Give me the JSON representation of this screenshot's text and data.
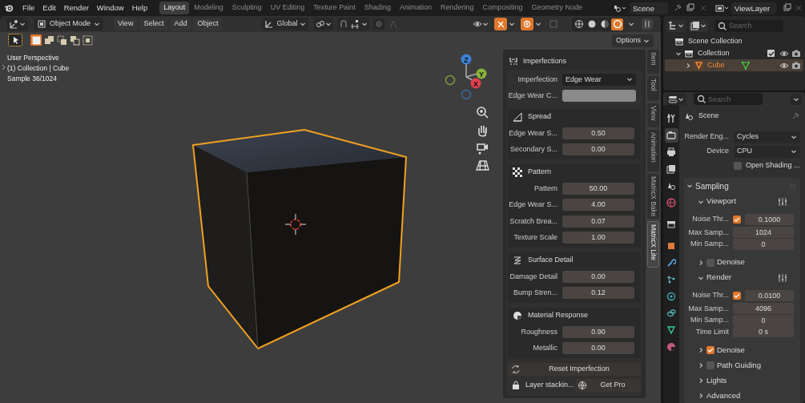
{
  "top_bar": {
    "menus": [
      "File",
      "Edit",
      "Render",
      "Window",
      "Help"
    ],
    "workspaces": [
      {
        "label": "Layout",
        "selected": true
      },
      {
        "label": "Modeling",
        "selected": false
      },
      {
        "label": "Sculpting",
        "selected": false
      },
      {
        "label": "UV Editing",
        "selected": false
      },
      {
        "label": "Texture Paint",
        "selected": false
      },
      {
        "label": "Shading",
        "selected": false
      },
      {
        "label": "Animation",
        "selected": false
      },
      {
        "label": "Rendering",
        "selected": false
      },
      {
        "label": "Compositing",
        "selected": false
      },
      {
        "label": "Geometry Node",
        "selected": false
      }
    ],
    "scene": "Scene",
    "view_layer": "ViewLayer"
  },
  "viewport": {
    "header": {
      "mode": "Object Mode",
      "menus": [
        "View",
        "Select",
        "Add",
        "Object"
      ],
      "orientation": "Global",
      "toggles": [
        {
          "kind": "gizmos",
          "on": true
        },
        {
          "kind": "overlays",
          "on": true
        },
        {
          "kind": "xray",
          "on": false
        }
      ],
      "shading": [
        {
          "kind": "wireframe",
          "selected": false
        },
        {
          "kind": "solid",
          "selected": false
        },
        {
          "kind": "material",
          "selected": false
        },
        {
          "kind": "rendered",
          "selected": true
        }
      ],
      "options": "Options"
    },
    "selection_modes": [
      {
        "kind": "set",
        "selected": true
      },
      {
        "kind": "extend",
        "selected": false
      },
      {
        "kind": "subtract",
        "selected": false
      },
      {
        "kind": "invert",
        "selected": false
      },
      {
        "kind": "intersect",
        "selected": false
      }
    ],
    "overlay_text": [
      "User Perspective",
      "(1) Collection | Cube",
      "Sample 36/1024"
    ],
    "gizmo": [
      "Z",
      "Y",
      "X"
    ]
  },
  "sidebar": {
    "title": "Imperfections",
    "imperfection": {
      "label": "Imperfection",
      "value": "Edge Wear"
    },
    "color": {
      "label": "Edge Wear C...",
      "color": "#8a8a8a"
    },
    "sections": [
      {
        "kind": "spread",
        "title": "Spread",
        "rows": [
          {
            "label": "Edge Wear S...",
            "value": "0.50"
          },
          {
            "label": "Secondary S...",
            "value": "0.00"
          }
        ]
      },
      {
        "kind": "pattern",
        "title": "Pattern",
        "rows": [
          {
            "label": "Pattern",
            "value": "50.00"
          },
          {
            "label": "Edge Wear S...",
            "value": "4.00"
          },
          {
            "label": "Scratch Brea...",
            "value": "0.07"
          },
          {
            "label": "Texture Scale",
            "value": "1.00"
          }
        ]
      },
      {
        "kind": "surface",
        "title": "Surface Detail",
        "rows": [
          {
            "label": "Damage Detail",
            "value": "0.00"
          },
          {
            "label": "Bump Stren...",
            "value": "0.12"
          }
        ]
      },
      {
        "kind": "material",
        "title": "Material Response",
        "rows": [
          {
            "label": "Roughness",
            "value": "0.90"
          },
          {
            "label": "Metallic",
            "value": "0.00"
          }
        ]
      }
    ],
    "reset_button": "Reset Imperfection",
    "footer": {
      "note": "Layer stackin...",
      "button": "Get Pro"
    },
    "tabs": [
      {
        "label": "Item",
        "selected": false
      },
      {
        "label": "Tool",
        "selected": false
      },
      {
        "label": "View",
        "selected": false
      },
      {
        "label": "Animation",
        "selected": false
      },
      {
        "label": "MatricX Bake",
        "selected": false
      },
      {
        "label": "MatricX Lite",
        "selected": true
      }
    ]
  },
  "outliner": {
    "search": {
      "placeholder": "Search"
    },
    "tree": [
      {
        "label": "Scene Collection",
        "selected": false,
        "children": [
          {
            "label": "Collection",
            "selected": false,
            "expanded": true,
            "checked": true,
            "children": [
              {
                "label": "Cube",
                "selected": true,
                "expanded": false
              }
            ]
          }
        ]
      }
    ]
  },
  "properties": {
    "search": {
      "placeholder": "Search"
    },
    "tabs": [
      {
        "kind": "tool",
        "selected": false
      },
      {
        "kind": "render",
        "selected": true
      },
      {
        "kind": "output",
        "selected": false
      },
      {
        "kind": "view_layer",
        "selected": false
      },
      {
        "kind": "scene",
        "selected": false
      },
      {
        "kind": "world",
        "selected": false
      },
      {
        "kind": "collection",
        "selected": false
      },
      {
        "kind": "object",
        "selected": false
      },
      {
        "kind": "modifiers",
        "selected": false
      },
      {
        "kind": "particles",
        "selected": false
      },
      {
        "kind": "physics",
        "selected": false
      },
      {
        "kind": "constraints",
        "selected": false
      },
      {
        "kind": "data",
        "selected": false
      },
      {
        "kind": "material",
        "selected": false
      }
    ],
    "context": "Scene",
    "fields": [
      {
        "kind": "dropdown",
        "label": "Render Eng...",
        "value": "Cycles"
      },
      {
        "kind": "dropdown",
        "label": "Device",
        "value": "CPU"
      },
      {
        "kind": "checkbox",
        "label": "Open Shading ...",
        "checked": false
      }
    ],
    "panel": {
      "title": "Sampling",
      "expanded": true,
      "items": [
        {
          "kind": "group",
          "title": "Viewport",
          "expanded": true
        },
        {
          "kind": "check_value",
          "label": "Noise Thr...",
          "checked": true,
          "value": "0.1000"
        },
        {
          "kind": "value",
          "label": "Max Samp...",
          "value": "1024"
        },
        {
          "kind": "value",
          "label": "Min Samp...",
          "value": "0"
        },
        {
          "kind": "toggle",
          "title": "Denoise",
          "expanded": false,
          "checked": false
        },
        {
          "kind": "group",
          "title": "Render",
          "expanded": true
        },
        {
          "kind": "check_value",
          "label": "Noise Thr...",
          "checked": true,
          "value": "0.0100"
        },
        {
          "kind": "value",
          "label": "Max Samp...",
          "value": "4096"
        },
        {
          "kind": "value",
          "label": "Min Samp...",
          "value": "0"
        },
        {
          "kind": "value",
          "label": "Time Limit",
          "value": "0 s"
        },
        {
          "kind": "toggle",
          "title": "Denoise",
          "expanded": false,
          "checked": true
        },
        {
          "kind": "toggle",
          "title": "Path Guiding",
          "expanded": false,
          "checked": false
        },
        {
          "kind": "option",
          "title": "Lights",
          "expanded": false
        },
        {
          "kind": "option",
          "title": "Advanced",
          "expanded": false
        }
      ]
    }
  }
}
